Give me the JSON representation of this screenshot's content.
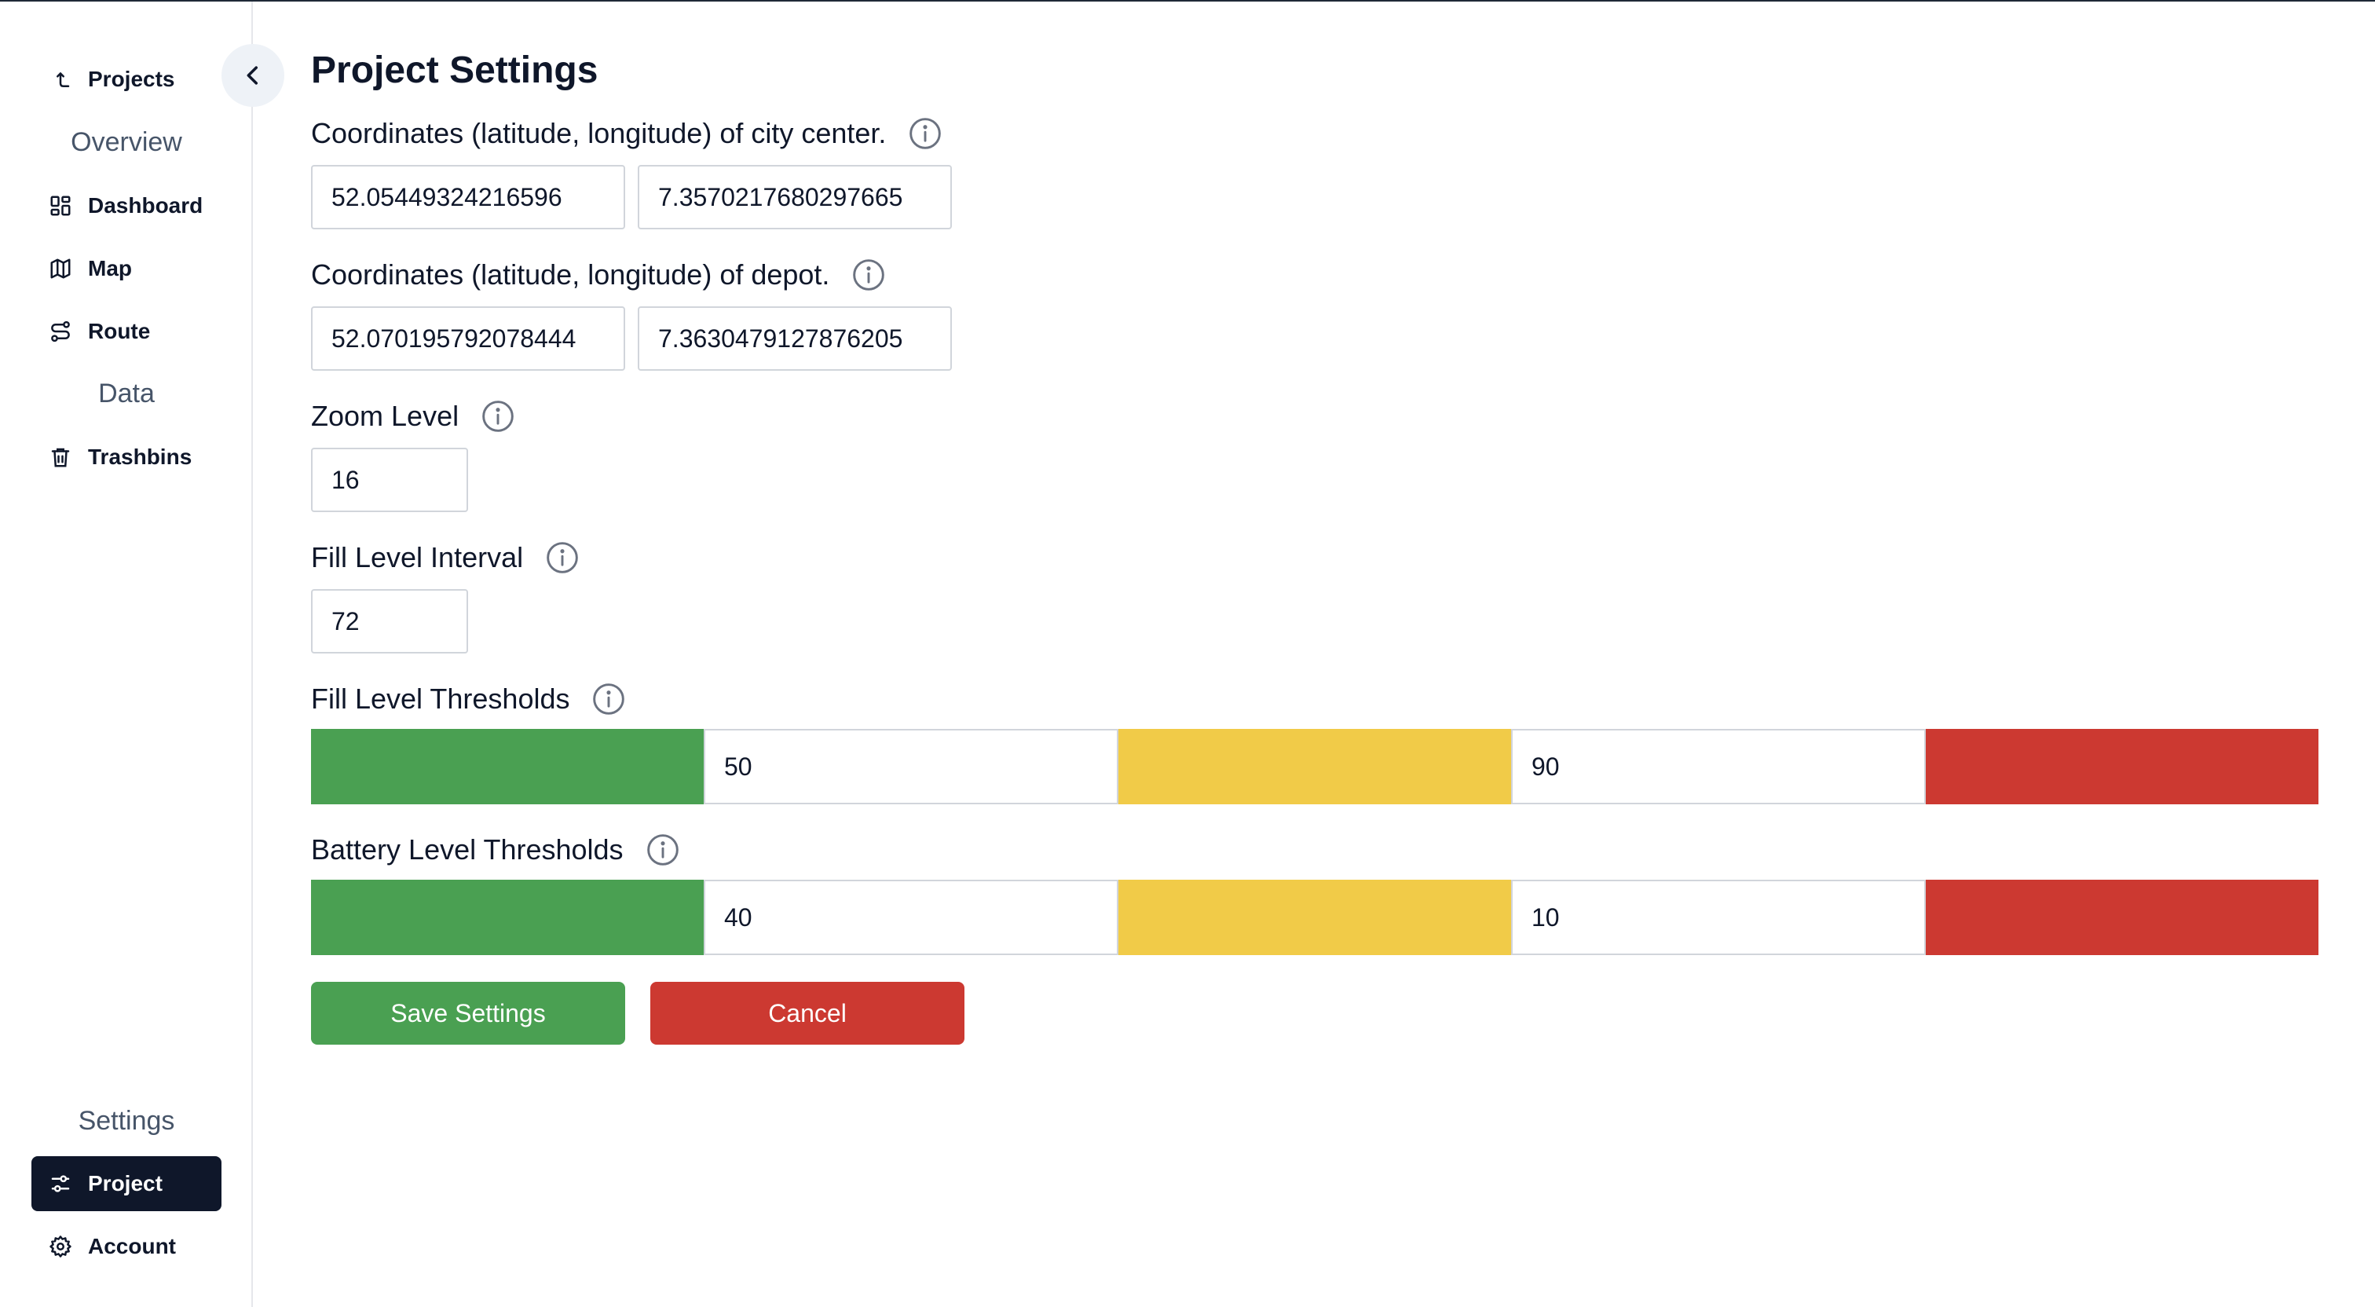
{
  "sidebar": {
    "projects_link": "Projects",
    "sections": [
      {
        "title": "Overview",
        "items": [
          {
            "label": "Dashboard",
            "icon": "dashboard-icon"
          },
          {
            "label": "Map",
            "icon": "map-icon"
          },
          {
            "label": "Route",
            "icon": "route-icon"
          }
        ]
      },
      {
        "title": "Data",
        "items": [
          {
            "label": "Trashbins",
            "icon": "trash-icon"
          }
        ]
      },
      {
        "title": "Settings",
        "items": [
          {
            "label": "Project",
            "icon": "sliders-icon",
            "active": true
          },
          {
            "label": "Account",
            "icon": "gear-icon"
          }
        ]
      }
    ]
  },
  "main": {
    "title": "Project Settings",
    "city_center": {
      "label": "Coordinates (latitude, longitude) of city center.",
      "latitude": "52.05449324216596",
      "longitude": "7.3570217680297665"
    },
    "depot": {
      "label": "Coordinates (latitude, longitude) of depot.",
      "latitude": "52.070195792078444",
      "longitude": "7.3630479127876205"
    },
    "zoom_level": {
      "label": "Zoom Level",
      "value": "16"
    },
    "fill_level_interval": {
      "label": "Fill Level Interval",
      "value": "72"
    },
    "fill_level_thresholds": {
      "label": "Fill Level Thresholds",
      "low": "50",
      "high": "90"
    },
    "battery_level_thresholds": {
      "label": "Battery Level Thresholds",
      "low": "40",
      "high": "10"
    },
    "save_label": "Save Settings",
    "cancel_label": "Cancel"
  },
  "colors": {
    "green": "#4aa052",
    "yellow": "#f1cb48",
    "red": "#cc3931",
    "sidebar_active": "#0f172a"
  }
}
